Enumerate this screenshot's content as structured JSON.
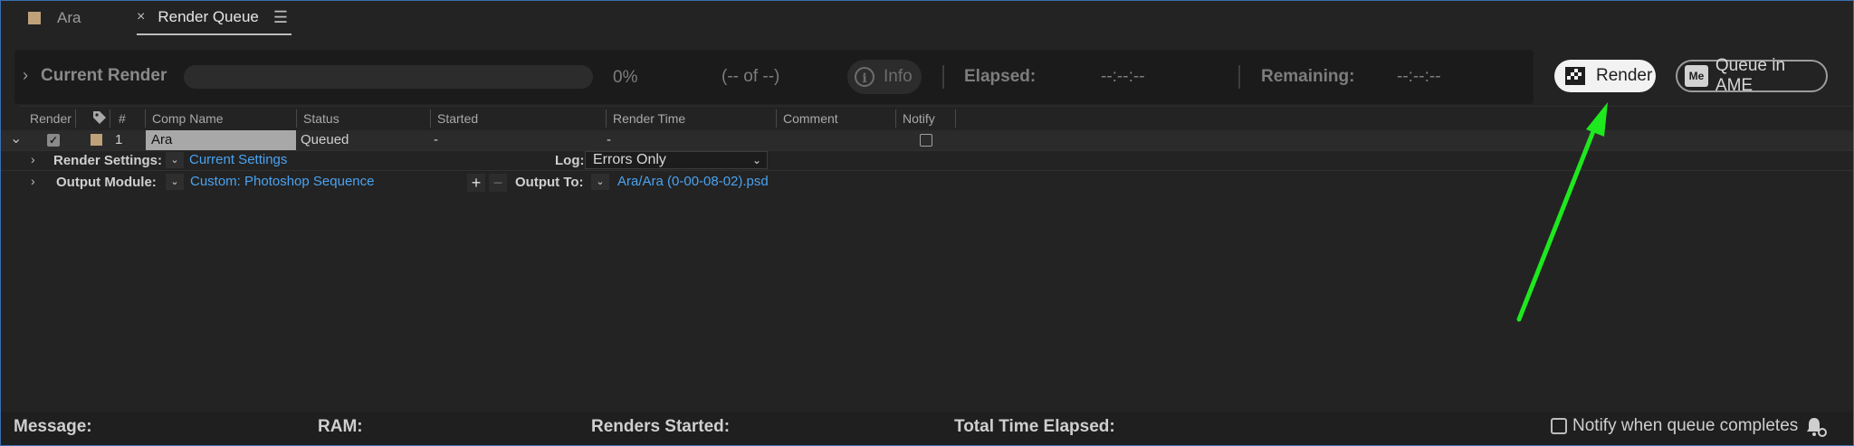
{
  "tabs": [
    {
      "label": "Ara",
      "color": "#bfa27a"
    },
    {
      "label": "Render Queue",
      "close_glyph": "×",
      "menu_glyph": "☰"
    }
  ],
  "current_render": {
    "chevron": "›",
    "title": "Current Render",
    "progress_percent": 0,
    "percent_text": "0%",
    "of_text": "(-- of --)",
    "info_label": "Info",
    "elapsed_label": "Elapsed:",
    "elapsed_value": "--:--:--",
    "remaining_label": "Remaining:",
    "remaining_value": "--:--:--"
  },
  "buttons": {
    "render_label": "Render",
    "ame_label": "Queue in AME",
    "ame_icon_text": "Me"
  },
  "columns": [
    "Render",
    "#",
    "Comp Name",
    "Status",
    "Started",
    "Render Time",
    "Comment",
    "Notify"
  ],
  "queue_items": [
    {
      "expand_glyph": "⌄",
      "render_checked": true,
      "label_color": "#bfa27a",
      "number": "1",
      "comp_name": "Ara",
      "status": "Queued",
      "started": "-",
      "render_time": "-",
      "notify_checked": false,
      "render_settings_label": "Render Settings:",
      "render_settings_value": "Current Settings",
      "log_label": "Log:",
      "log_value": "Errors Only",
      "output_module_label": "Output Module:",
      "output_module_value": "Custom: Photoshop Sequence",
      "output_to_label": "Output To:",
      "output_to_value": "Ara/Ara (0-00-08-02).psd"
    }
  ],
  "status_bar": {
    "message_label": "Message:",
    "ram_label": "RAM:",
    "renders_started_label": "Renders Started:",
    "total_time_label": "Total Time Elapsed:",
    "notify_label": "Notify when queue completes"
  },
  "annotation": {
    "color": "#1ee81e"
  }
}
